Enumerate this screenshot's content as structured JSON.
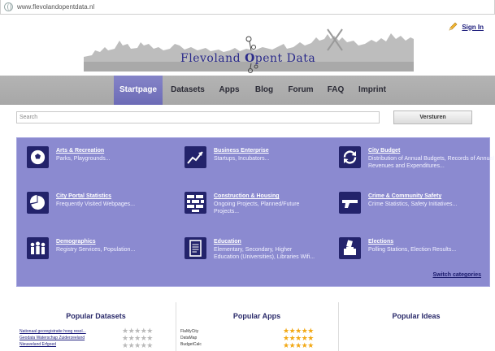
{
  "browser": {
    "url": "www.flevolandopentdata.nl"
  },
  "header": {
    "signin_label": "Sign In",
    "logo_prefix": "Flevoland ",
    "logo_o": "O",
    "logo_suffix": "pent Data"
  },
  "nav": {
    "items": [
      "Startpage",
      "Datasets",
      "Apps",
      "Blog",
      "Forum",
      "FAQ",
      "Imprint"
    ],
    "active": "Startpage"
  },
  "search": {
    "placeholder": "Search",
    "button_label": "Versturen"
  },
  "categories": [
    {
      "title": "Arts & Recreation",
      "desc": "Parks, Playgrounds...",
      "icon": "soccer-ball-icon"
    },
    {
      "title": "Business Enterprise",
      "desc": "Startups, Incubators...",
      "icon": "trend-chart-icon"
    },
    {
      "title": "City Budget",
      "desc": "Distribution of Annual Budgets, Records of Annual Revenues and Expenditures...",
      "icon": "refresh-cycle-icon"
    },
    {
      "title": "City Portal Statistics",
      "desc": "Frequently Visited Webpages...",
      "icon": "pie-chart-icon"
    },
    {
      "title": "Construction & Housing",
      "desc": "Ongoing Projects, Planned/Future Projects...",
      "icon": "brick-wall-icon"
    },
    {
      "title": "Crime & Community Safety",
      "desc": "Crime Statistics, Safety Initiatives...",
      "icon": "gun-icon"
    },
    {
      "title": "Demographics",
      "desc": "Registry Services, Population...",
      "icon": "people-icon"
    },
    {
      "title": "Education",
      "desc": "Elementary, Secondary, Higher Education (Universities), Libraries Wifi...",
      "icon": "document-icon"
    },
    {
      "title": "Elections",
      "desc": "Polling Stations, Election Results...",
      "icon": "ballot-box-icon"
    }
  ],
  "switch_label": "Switch categories",
  "popular": {
    "datasets_title": "Popular Datasets",
    "apps_title": "Popular Apps",
    "ideas_title": "Popular Ideas",
    "datasets": [
      "Nationaal georegistratie hoog resol...",
      "Geodata Waterschap Zuiderzeeland",
      "Nieuweland Erfgoed"
    ],
    "apps": [
      "FlaMyCity",
      "DataMap",
      "BudgetCalc"
    ]
  }
}
